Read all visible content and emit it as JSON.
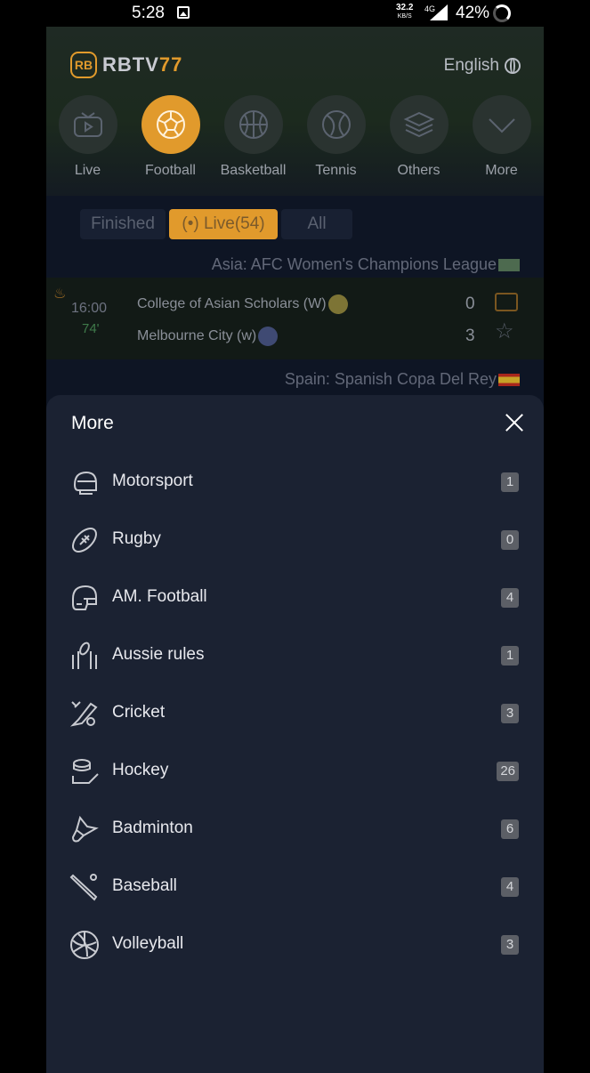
{
  "status_bar": {
    "time": "5:28",
    "speed": "32.2",
    "speed_unit": "KB/S",
    "network": "4G",
    "battery": "42%"
  },
  "brand": {
    "rb": "RB",
    "name": "RBTV",
    "name_suffix": "77",
    "accent": "#e19a2c"
  },
  "language": "English",
  "categories": [
    {
      "label": "Live",
      "icon": "tv-icon",
      "active": false
    },
    {
      "label": "Football",
      "icon": "football-icon",
      "active": true
    },
    {
      "label": "Basketball",
      "icon": "basketball-icon",
      "active": false
    },
    {
      "label": "Tennis",
      "icon": "tennis-icon",
      "active": false
    },
    {
      "label": "Others",
      "icon": "layers-icon",
      "active": false
    },
    {
      "label": "More",
      "icon": "chevron-down-icon",
      "active": false
    }
  ],
  "filters": {
    "finished": "Finished",
    "live": "Live(54)",
    "all": "All"
  },
  "leagues": [
    {
      "name": "Asia: AFC Women's Champions League"
    },
    {
      "name": "Spain: Spanish Copa Del Rey"
    }
  ],
  "match": {
    "kickoff": "16:00",
    "minute": "74'",
    "home": "College of Asian Scholars (W)",
    "away": "Melbourne City (w)",
    "home_score": "0",
    "away_score": "3"
  },
  "sheet": {
    "title": "More",
    "items": [
      {
        "label": "Motorsport",
        "count": "1",
        "icon": "motorsport-helmet-icon"
      },
      {
        "label": "Rugby",
        "count": "0",
        "icon": "rugby-ball-icon"
      },
      {
        "label": "AM. Football",
        "count": "4",
        "icon": "football-helmet-icon"
      },
      {
        "label": "Aussie rules",
        "count": "1",
        "icon": "aussie-rules-icon"
      },
      {
        "label": "Cricket",
        "count": "3",
        "icon": "cricket-bat-icon"
      },
      {
        "label": "Hockey",
        "count": "26",
        "icon": "hockey-stick-icon"
      },
      {
        "label": "Badminton",
        "count": "6",
        "icon": "shuttlecock-icon"
      },
      {
        "label": "Baseball",
        "count": "4",
        "icon": "baseball-bat-icon"
      },
      {
        "label": "Volleyball",
        "count": "3",
        "icon": "volleyball-icon"
      }
    ]
  }
}
